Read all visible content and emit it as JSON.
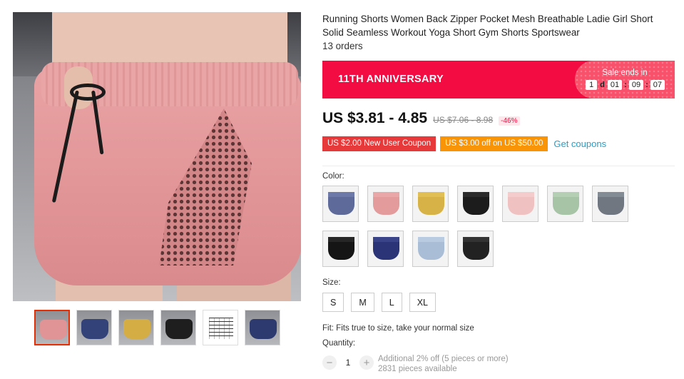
{
  "product": {
    "title": "Running Shorts Women Back Zipper Pocket Mesh Breathable Ladie Girl Short Solid Seamless Workout Yoga Short Gym Shorts Sportswear",
    "orders": "13 orders"
  },
  "banner": {
    "label": "11TH ANNIVERSARY",
    "sale_ends": "Sale ends in",
    "days": "1",
    "day_suffix": "d",
    "hours": "01",
    "minutes": "09",
    "seconds": "07",
    "color": "#f30c41"
  },
  "price": {
    "current": "US $3.81 - 4.85",
    "original": "US $7.06 - 8.98",
    "discount": "-46%"
  },
  "coupons": {
    "new_user": "US $2.00 New User Coupon",
    "store": "US $3.00 off on US $50.00",
    "get": "Get coupons"
  },
  "color": {
    "label": "Color:",
    "options": [
      {
        "swatch": "#5d6a9a",
        "waist": "#6d79a8"
      },
      {
        "swatch": "#e39b9c",
        "waist": "#eaa7a8"
      },
      {
        "swatch": "#d6b247",
        "waist": "#e1bf55"
      },
      {
        "swatch": "#1c1c1c",
        "waist": "#2b2b2b"
      },
      {
        "swatch": "#efc2c1",
        "waist": "#f4cccb"
      },
      {
        "swatch": "#a7c4a6",
        "waist": "#b4cfb3"
      },
      {
        "swatch": "#707780",
        "waist": "#838b94"
      },
      {
        "swatch": "#151515",
        "waist": "#262626"
      },
      {
        "swatch": "#2a3477",
        "waist": "#3a4489"
      },
      {
        "swatch": "#a9bdd6",
        "waist": "#b9cbe0"
      },
      {
        "swatch": "#222222",
        "waist": "#333333"
      }
    ]
  },
  "size": {
    "label": "Size:",
    "options": [
      "S",
      "M",
      "L",
      "XL"
    ]
  },
  "fit": "Fit: Fits true to size, take your normal size",
  "quantity": {
    "label": "Quantity:",
    "value": "1",
    "minus": "−",
    "plus": "+",
    "additional": "Additional 2% off (5 pieces or more)",
    "available": "2831 pieces available"
  },
  "thumbnails": [
    {
      "color": "#e19496",
      "type": "photo"
    },
    {
      "color": "#34427a",
      "type": "photo"
    },
    {
      "color": "#d4ad45",
      "type": "photo"
    },
    {
      "color": "#1e1e1e",
      "type": "photo"
    },
    {
      "color": "#ffffff",
      "type": "size-chart"
    },
    {
      "color": "#2d3a6f",
      "type": "photo"
    }
  ]
}
